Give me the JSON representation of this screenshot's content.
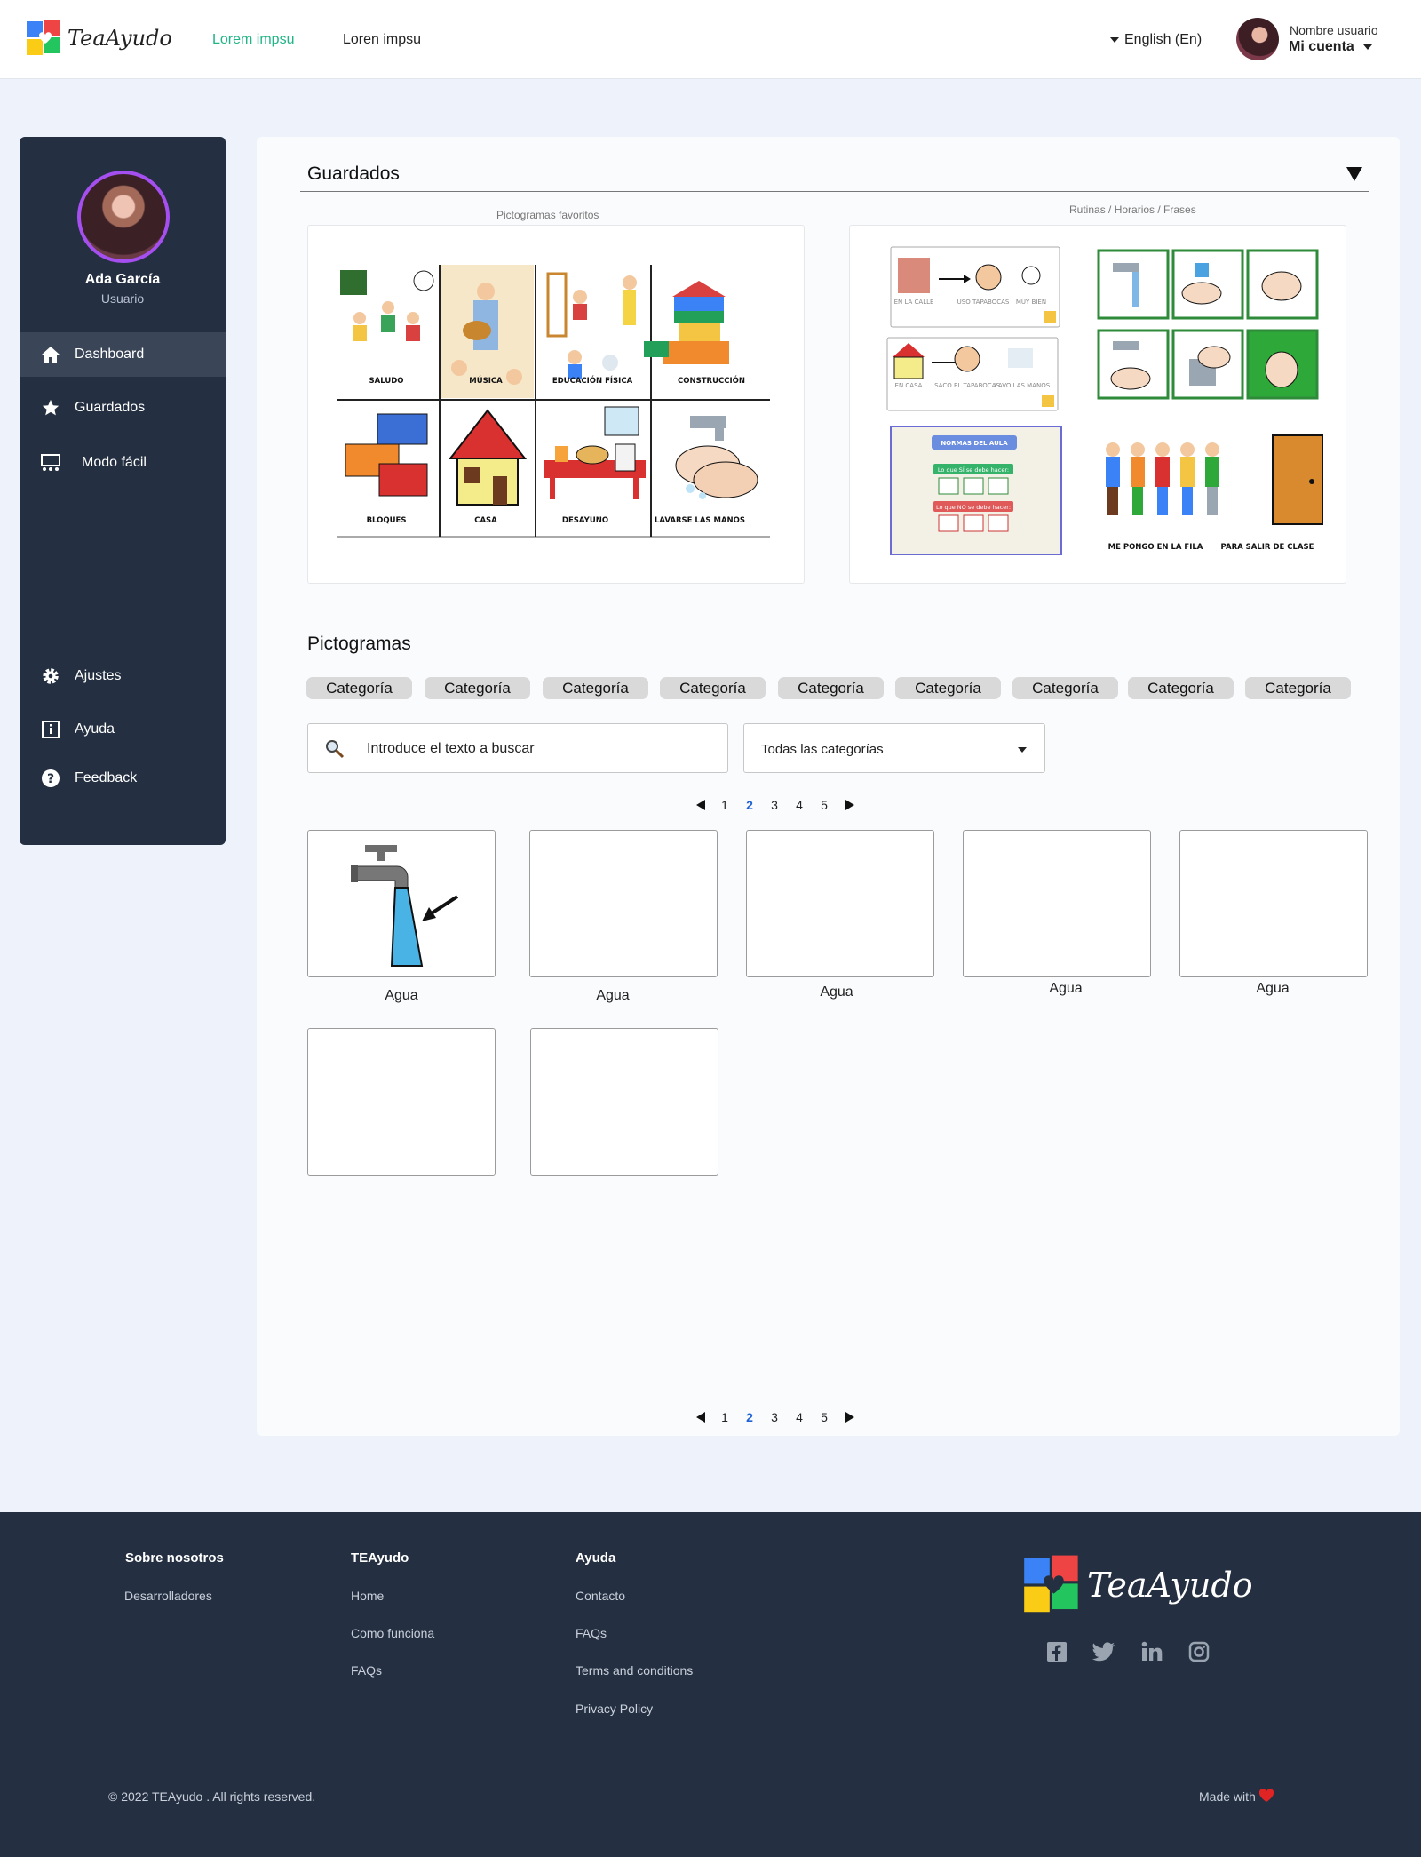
{
  "header": {
    "logo_text": "TeaAyudo",
    "nav": [
      "Lorem impsu",
      "Loren impsu"
    ],
    "language": "English (En)",
    "account_label": "Nombre usuario",
    "account_name": "Mi cuenta"
  },
  "sidebar": {
    "user_name": "Ada García",
    "user_role": "Usuario",
    "items": [
      {
        "label": "Dashboard",
        "icon": "home-icon"
      },
      {
        "label": "Guardados",
        "icon": "star-icon"
      },
      {
        "label": "Modo fácil",
        "icon": "easy-mode-icon"
      }
    ],
    "bottom_items": [
      {
        "label": "Ajustes",
        "icon": "gear-icon"
      },
      {
        "label": "Ayuda",
        "icon": "info-icon"
      },
      {
        "label": "Feedback",
        "icon": "question-icon"
      }
    ]
  },
  "saved": {
    "title": "Guardados",
    "favorites_label": "Pictogramas favoritos",
    "routines_label": "Rutinas / Horarios / Frases",
    "favorites": [
      "SALUDO",
      "MÚSICA",
      "EDUCACIÓN FÍSICA",
      "CONSTRUCCIÓN",
      "BLOQUES",
      "CASA",
      "DESAYUNO",
      "LAVARSE LAS MANOS"
    ],
    "routine_captions": [
      "EN LA CALLE",
      "USO TAPABOCAS",
      "MUY BIEN",
      "EN CASA",
      "SACO EL TAPABOCAS",
      "LAVO LAS MANOS"
    ],
    "rules_board": {
      "title": "NORMAS DEL AULA",
      "do": "Lo que SÍ se debe hacer:",
      "dont": "Lo que NO se debe hacer:"
    },
    "line_captions": [
      "ME PONGO EN LA FILA",
      "PARA SALIR DE CLASE"
    ]
  },
  "pictograms": {
    "title": "Pictogramas",
    "categories": [
      "Categoría",
      "Categoría",
      "Categoría",
      "Categoría",
      "Categoría",
      "Categoría",
      "Categoría",
      "Categoría",
      "Categoría"
    ],
    "search_placeholder": "Introduce el texto a buscar",
    "filter_value": "Todas las categorías",
    "pages": [
      "1",
      "2",
      "3",
      "4",
      "5"
    ],
    "current_page": "2",
    "items": [
      "Agua",
      "Agua",
      "Agua",
      "Agua",
      "Agua"
    ]
  },
  "footer": {
    "columns": [
      {
        "title": "Sobre nosotros",
        "links": [
          "Desarrolladores"
        ]
      },
      {
        "title": "TEAyudo",
        "links": [
          "Home",
          "Como funciona",
          "FAQs"
        ]
      },
      {
        "title": "Ayuda",
        "links": [
          "Contacto",
          "FAQs",
          "Terms and conditions",
          "Privacy Policy"
        ]
      }
    ],
    "logo_text": "TeaAyudo",
    "social": [
      "facebook-icon",
      "twitter-icon",
      "linkedin-icon",
      "instagram-icon"
    ],
    "copyright": "© 2022 TEAyudo  . All rights reserved.",
    "made_with": "Made with"
  },
  "colors": {
    "accent": "#20b486",
    "sidebar": "#243041",
    "page_link": "#1f63d6",
    "avatar_ring": "#a64ff0"
  }
}
